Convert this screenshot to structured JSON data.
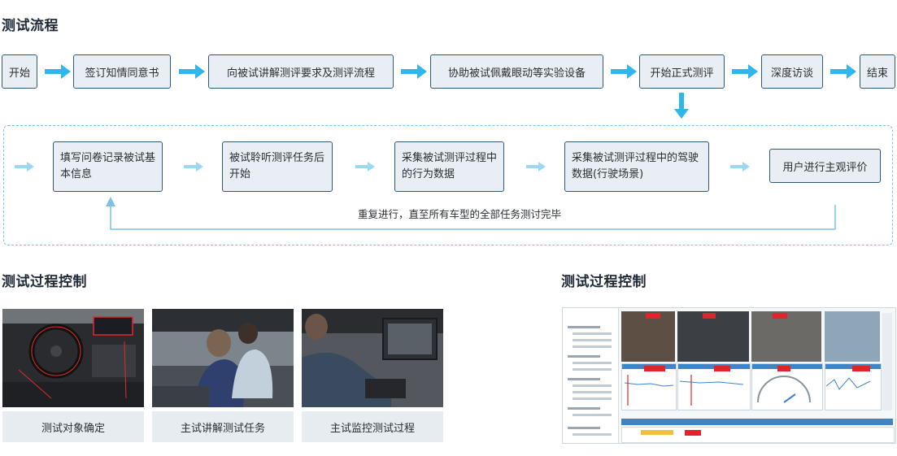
{
  "section_titles": {
    "flow": "测试流程",
    "control_left": "测试过程控制",
    "control_right": "测试过程控制"
  },
  "flow_steps": [
    "开始",
    "签订知情同意书",
    "向被试讲解测评要求及测评流程",
    "协助被试佩戴眼动等实验设备",
    "开始正式测评",
    "深度访谈",
    "结束"
  ],
  "loop_steps": [
    "填写问卷记录被试基本信息",
    "被试聆听测评任务后开始",
    "采集被试测评过程中的行为数据",
    "采集被试测评过程中的驾驶数据(行驶场景)",
    "用户进行主观评价"
  ],
  "loop_note": "重复进行，直至所有车型的全部任务测讨完毕",
  "photo_captions": [
    "测试对象确定",
    "主试讲解测试任务",
    "主试监控测试过程"
  ],
  "colors": {
    "arrow": "#31b6ec",
    "box_border": "#2e5877",
    "box_fill": "#e8eef3",
    "dashed_border": "#7fbfe8"
  }
}
